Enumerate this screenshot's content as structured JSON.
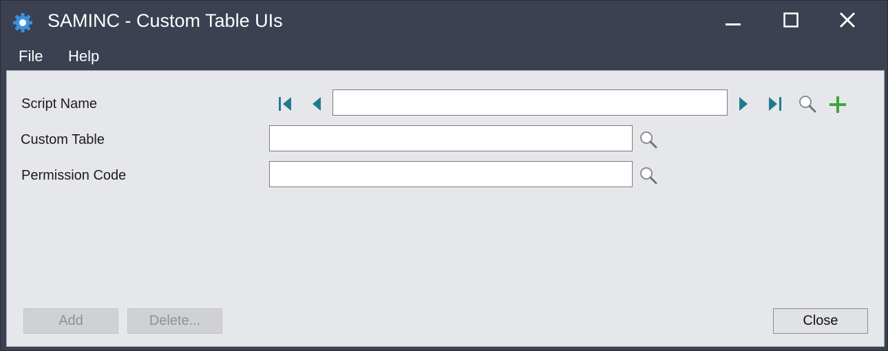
{
  "window": {
    "title": "SAMINC - Custom Table UIs"
  },
  "menu": {
    "items": [
      "File",
      "Help"
    ]
  },
  "form": {
    "fields": [
      {
        "label": "Script Name",
        "value": ""
      },
      {
        "label": "Custom Table",
        "value": ""
      },
      {
        "label": "Permission Code",
        "value": ""
      }
    ]
  },
  "buttons": {
    "add": "Add",
    "delete": "Delete...",
    "close": "Close"
  },
  "icons": {
    "app": "gear-icon",
    "minimize": "minimize-icon",
    "maximize": "maximize-icon",
    "close": "close-icon",
    "first": "first-record-icon",
    "prev": "previous-record-icon",
    "next": "next-record-icon",
    "last": "last-record-icon",
    "lookup": "magnifier-icon",
    "new": "plus-icon"
  },
  "colors": {
    "titlebar": "#3b4150",
    "accent": "#1e7b8f",
    "plus": "#3aa63a",
    "appicon": "#3d8fe0"
  }
}
